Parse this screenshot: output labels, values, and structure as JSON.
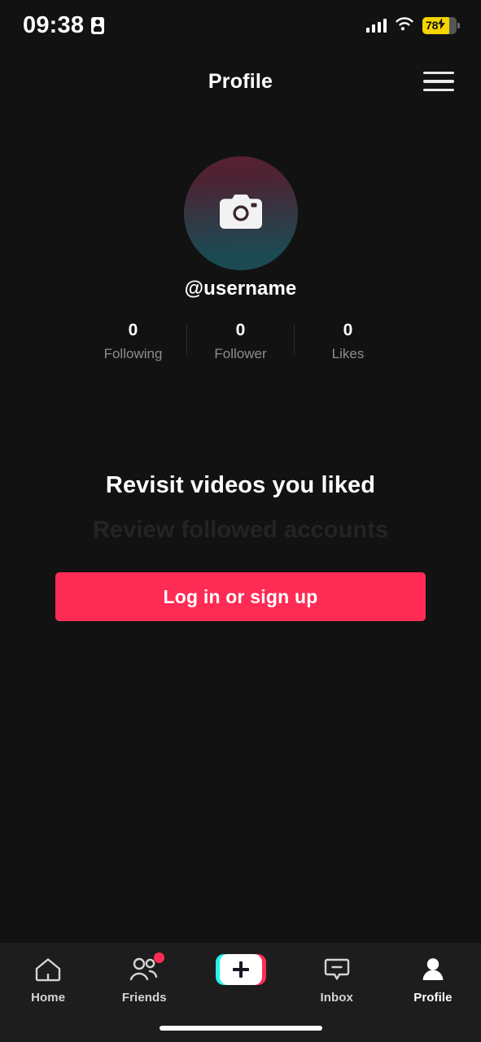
{
  "status_bar": {
    "time": "09:38",
    "id_icon": "contact-card-icon",
    "signal_icon": "cellular-signal-icon",
    "wifi_icon": "wifi-icon",
    "battery_percent": "78",
    "battery_charging": true,
    "battery_color": "#F5D600"
  },
  "header": {
    "title": "Profile",
    "menu_icon": "hamburger-menu-icon"
  },
  "profile": {
    "avatar_icon": "camera-icon",
    "avatar_gradient_top": "#5a2030",
    "avatar_gradient_bottom": "#1b4b53",
    "username": "@username",
    "stats": [
      {
        "count": "0",
        "label": "Following"
      },
      {
        "count": "0",
        "label": "Follower"
      },
      {
        "count": "0",
        "label": "Likes"
      }
    ]
  },
  "promo": {
    "headline": "Revisit videos you liked",
    "next_headline": "Review followed accounts",
    "login_button": "Log in or sign up",
    "accent_color": "#FE2C55"
  },
  "bottom_nav": {
    "items": [
      {
        "label": "Home",
        "icon": "home-icon",
        "active": false,
        "badge": false
      },
      {
        "label": "Friends",
        "icon": "friends-icon",
        "active": false,
        "badge": true
      },
      {
        "label": "",
        "icon": "create-plus-icon",
        "active": false,
        "badge": false
      },
      {
        "label": "Inbox",
        "icon": "inbox-icon",
        "active": false,
        "badge": false
      },
      {
        "label": "Profile",
        "icon": "profile-person-icon",
        "active": true,
        "badge": false
      }
    ],
    "create_cyan": "#25F4EE",
    "create_pink": "#FE2C55"
  },
  "home_indicator": "home-indicator-bar"
}
